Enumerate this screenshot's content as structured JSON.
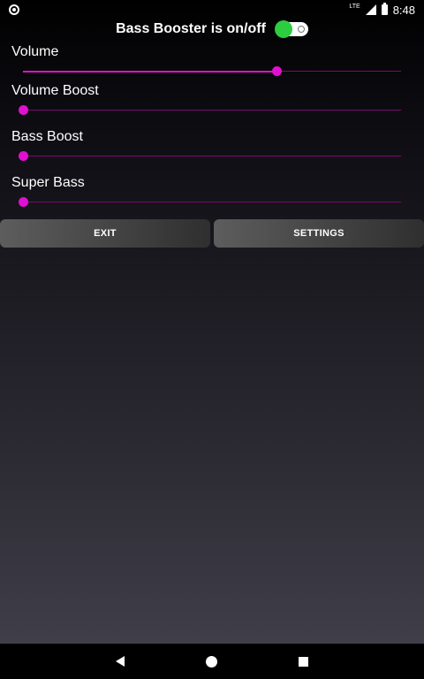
{
  "status_bar": {
    "network_label": "LTE",
    "time": "8:48",
    "icons": [
      "notification-circle-icon",
      "signal-icon",
      "battery-icon"
    ]
  },
  "header": {
    "title": "Bass Booster is on/off",
    "toggle_state": "on"
  },
  "sliders": [
    {
      "label": "Volume",
      "value_percent": 67
    },
    {
      "label": "Volume Boost",
      "value_percent": 0
    },
    {
      "label": "Bass Boost",
      "value_percent": 0
    },
    {
      "label": "Super Bass",
      "value_percent": 0
    }
  ],
  "buttons": {
    "exit_label": "EXIT",
    "settings_label": "SETTINGS"
  },
  "nav_bar": {
    "icons": [
      "back-icon",
      "home-icon",
      "recents-icon"
    ]
  },
  "colors": {
    "accent": "#e010d0",
    "track": "#7a0b72",
    "toggle_on": "#2ecc40"
  }
}
